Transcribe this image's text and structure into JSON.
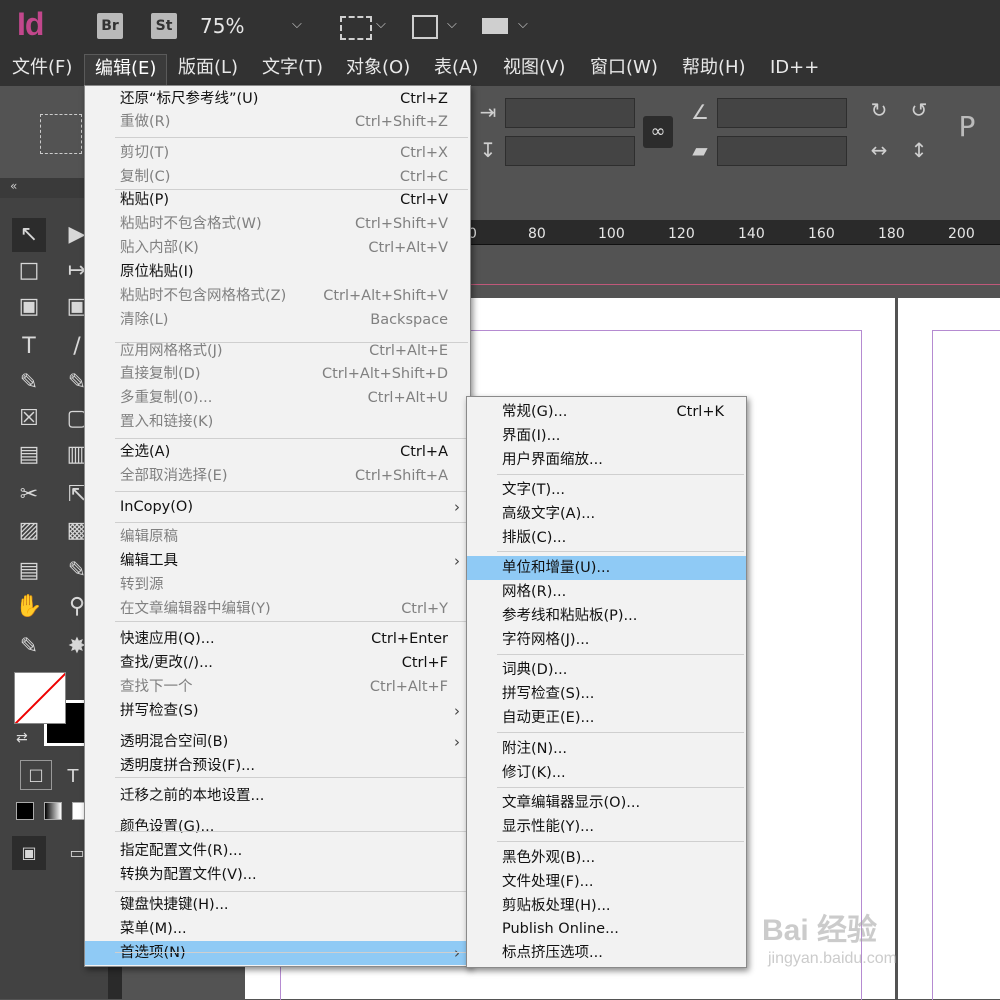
{
  "appbar": {
    "logo": "Id",
    "bridge": "Br",
    "stock": "St",
    "zoom": "75%"
  },
  "menubar": [
    {
      "label": "文件(F)"
    },
    {
      "label": "编辑(E)"
    },
    {
      "label": "版面(L)"
    },
    {
      "label": "文字(T)"
    },
    {
      "label": "对象(O)"
    },
    {
      "label": "表(A)"
    },
    {
      "label": "视图(V)"
    },
    {
      "label": "窗口(W)"
    },
    {
      "label": "帮助(H)"
    },
    {
      "label": "ID++"
    }
  ],
  "edit_menu": [
    {
      "label": "还原“标尺参考线”(U)",
      "shortcut": "Ctrl+Z",
      "enabled": true
    },
    {
      "label": "重做(R)",
      "shortcut": "Ctrl+Shift+Z",
      "enabled": false
    },
    {
      "label": "剪切(T)",
      "shortcut": "Ctrl+X",
      "enabled": false
    },
    {
      "label": "复制(C)",
      "shortcut": "Ctrl+C",
      "enabled": false
    },
    {
      "label": "粘贴(P)",
      "shortcut": "Ctrl+V",
      "enabled": true
    },
    {
      "label": "粘贴时不包含格式(W)",
      "shortcut": "Ctrl+Shift+V",
      "enabled": false
    },
    {
      "label": "贴入内部(K)",
      "shortcut": "Ctrl+Alt+V",
      "enabled": false
    },
    {
      "label": "原位粘贴(I)",
      "shortcut": "",
      "enabled": true
    },
    {
      "label": "粘贴时不包含网格格式(Z)",
      "shortcut": "Ctrl+Alt+Shift+V",
      "enabled": false
    },
    {
      "label": "清除(L)",
      "shortcut": "Backspace",
      "enabled": false
    },
    {
      "label": "应用网格格式(J)",
      "shortcut": "Ctrl+Alt+E",
      "enabled": false
    },
    {
      "label": "直接复制(D)",
      "shortcut": "Ctrl+Alt+Shift+D",
      "enabled": false
    },
    {
      "label": "多重复制(0)...",
      "shortcut": "Ctrl+Alt+U",
      "enabled": false
    },
    {
      "label": "置入和链接(K)",
      "shortcut": "",
      "enabled": false
    },
    {
      "label": "全选(A)",
      "shortcut": "Ctrl+A",
      "enabled": true
    },
    {
      "label": "全部取消选择(E)",
      "shortcut": "Ctrl+Shift+A",
      "enabled": false
    },
    {
      "label": "InCopy(O)",
      "shortcut": "",
      "enabled": true,
      "submenu": true
    },
    {
      "label": "编辑原稿",
      "shortcut": "",
      "enabled": false
    },
    {
      "label": "编辑工具",
      "shortcut": "",
      "enabled": true,
      "submenu": true
    },
    {
      "label": "转到源",
      "shortcut": "",
      "enabled": false
    },
    {
      "label": "在文章编辑器中编辑(Y)",
      "shortcut": "Ctrl+Y",
      "enabled": false
    },
    {
      "label": "快速应用(Q)...",
      "shortcut": "Ctrl+Enter",
      "enabled": true
    },
    {
      "label": "查找/更改(/)...",
      "shortcut": "Ctrl+F",
      "enabled": true
    },
    {
      "label": "查找下一个",
      "shortcut": "Ctrl+Alt+F",
      "enabled": false
    },
    {
      "label": "拼写检查(S)",
      "shortcut": "",
      "enabled": true,
      "submenu": true
    },
    {
      "label": "透明混合空间(B)",
      "shortcut": "",
      "enabled": true,
      "submenu": true
    },
    {
      "label": "透明度拼合预设(F)...",
      "shortcut": "",
      "enabled": true
    },
    {
      "label": "迁移之前的本地设置...",
      "shortcut": "",
      "enabled": true
    },
    {
      "label": "颜色设置(G)...",
      "shortcut": "",
      "enabled": true
    },
    {
      "label": "指定配置文件(R)...",
      "shortcut": "",
      "enabled": true
    },
    {
      "label": "转换为配置文件(V)...",
      "shortcut": "",
      "enabled": true
    },
    {
      "label": "键盘快捷键(H)...",
      "shortcut": "",
      "enabled": true
    },
    {
      "label": "菜单(M)...",
      "shortcut": "",
      "enabled": true
    },
    {
      "label": "首选项(N)",
      "shortcut": "",
      "enabled": true,
      "submenu": true,
      "highlighted": true
    }
  ],
  "prefs_menu": [
    {
      "label": "常规(G)...",
      "shortcut": "Ctrl+K"
    },
    {
      "label": "界面(I)...",
      "shortcut": ""
    },
    {
      "label": "用户界面缩放...",
      "shortcut": ""
    },
    {
      "label": "文字(T)...",
      "shortcut": ""
    },
    {
      "label": "高级文字(A)...",
      "shortcut": ""
    },
    {
      "label": "排版(C)...",
      "shortcut": ""
    },
    {
      "label": "单位和增量(U)...",
      "shortcut": "",
      "highlighted": true
    },
    {
      "label": "网格(R)...",
      "shortcut": ""
    },
    {
      "label": "参考线和粘贴板(P)...",
      "shortcut": ""
    },
    {
      "label": "字符网格(J)...",
      "shortcut": ""
    },
    {
      "label": "词典(D)...",
      "shortcut": ""
    },
    {
      "label": "拼写检查(S)...",
      "shortcut": ""
    },
    {
      "label": "自动更正(E)...",
      "shortcut": ""
    },
    {
      "label": "附注(N)...",
      "shortcut": ""
    },
    {
      "label": "修订(K)...",
      "shortcut": ""
    },
    {
      "label": "文章编辑器显示(O)...",
      "shortcut": ""
    },
    {
      "label": "显示性能(Y)...",
      "shortcut": ""
    },
    {
      "label": "黑色外观(B)...",
      "shortcut": ""
    },
    {
      "label": "文件处理(F)...",
      "shortcut": ""
    },
    {
      "label": "剪贴板处理(H)...",
      "shortcut": ""
    },
    {
      "label": "Publish Online...",
      "shortcut": ""
    },
    {
      "label": "标点挤压选项...",
      "shortcut": ""
    }
  ],
  "ruler": {
    "ticks": [
      "0",
      "80",
      "100",
      "120",
      "140",
      "160",
      "180",
      "200"
    ]
  },
  "watermark": {
    "brand": "Bai 经验",
    "url": "jingyan.baidu.com"
  }
}
